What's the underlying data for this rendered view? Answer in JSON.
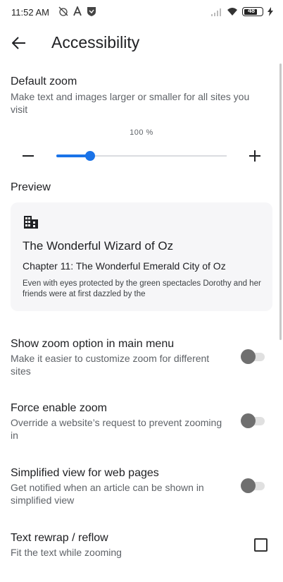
{
  "status_bar": {
    "time": "11:52 AM",
    "left_icons": [
      "alarm-off-icon",
      "font-a-icon",
      "shield-icon"
    ],
    "right_icons": [
      "signal-icon",
      "wifi-icon",
      "battery-icon",
      "charging-icon"
    ],
    "battery_level": "48"
  },
  "app_bar": {
    "back_icon": "arrow-back-icon",
    "title": "Accessibility"
  },
  "default_zoom": {
    "title": "Default zoom",
    "description": "Make text and images larger or smaller for all sites you visit",
    "value_text": "100 %",
    "slider_fraction": 0.2,
    "minus_icon": "minus-icon",
    "plus_icon": "plus-icon",
    "accent_color": "#1a73e8"
  },
  "preview": {
    "label": "Preview",
    "icon": "building-icon",
    "heading": "The Wonderful Wizard of Oz",
    "subheading": "Chapter 11: The Wonderful Emerald City of Oz",
    "body": "Even with eyes protected by the green spectacles Dorothy and her friends were at first dazzled by the"
  },
  "settings": [
    {
      "title": "Show zoom option in main menu",
      "description": "Make it easier to customize zoom for different sites",
      "control": "toggle",
      "checked": false
    },
    {
      "title": "Force enable zoom",
      "description": "Override a website’s request to prevent zooming in",
      "control": "toggle",
      "checked": false
    },
    {
      "title": "Simplified view for web pages",
      "description": "Get notified when an article can be shown in simplified view",
      "control": "toggle",
      "checked": false
    },
    {
      "title": "Text rewrap / reflow",
      "description": "Fit the text while zooming",
      "control": "checkbox",
      "checked": false
    }
  ]
}
